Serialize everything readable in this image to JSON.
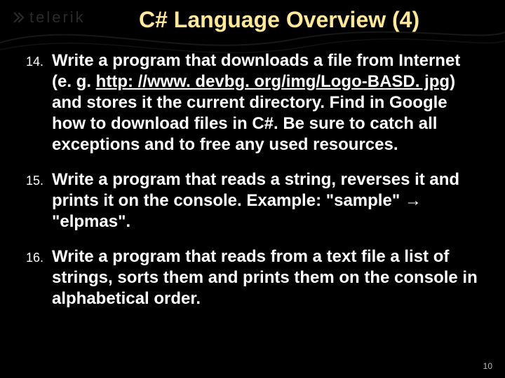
{
  "logo": {
    "text": "telerik"
  },
  "title": "C# Language Overview (4)",
  "items": [
    {
      "num": "14.",
      "prefix": "Write a program that downloads a file from Internet (e. g. ",
      "link": "http: //www. devbg. org/img/Logo-BASD. jpg",
      "suffix": ") and stores it the current directory. Find in Google how to download files in C#. Be sure to catch all exceptions and to free any used resources."
    },
    {
      "num": "15.",
      "text": "Write a program that reads a string, reverses it and prints it on the console. Example: \"sample\" → \"elpmas\"."
    },
    {
      "num": "16.",
      "text": "Write a program that reads from a text file a list of strings, sorts them and prints them on the console in alphabetical order."
    }
  ],
  "pageNumber": "10"
}
